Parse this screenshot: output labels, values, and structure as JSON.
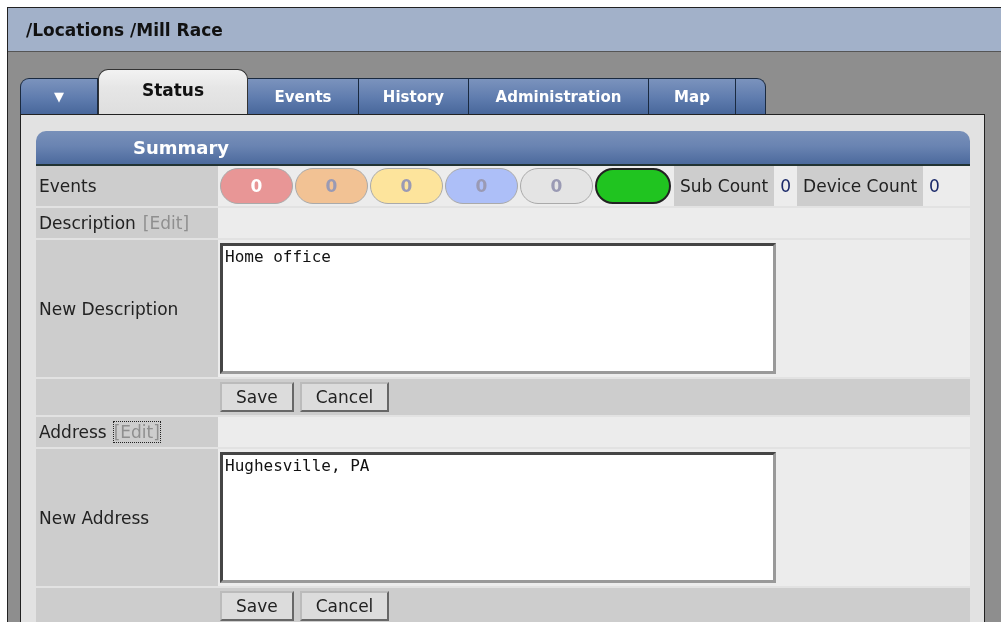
{
  "window": {
    "title": "/Locations /Mill Race"
  },
  "tabs": [
    {
      "kind": "menu",
      "label": "▼",
      "selected": false
    },
    {
      "kind": "tab",
      "label": "Status",
      "selected": true
    },
    {
      "kind": "tab",
      "label": "Events",
      "selected": false
    },
    {
      "kind": "tab",
      "label": "History",
      "selected": false
    },
    {
      "kind": "tab",
      "label": "Administration",
      "selected": false
    },
    {
      "kind": "tab",
      "label": "Map",
      "selected": false
    },
    {
      "kind": "stub",
      "selected": false
    }
  ],
  "summary": {
    "title": "Summary",
    "events": {
      "label": "Events",
      "pills": [
        {
          "count": "0",
          "color": "#e89696"
        },
        {
          "count": "0",
          "color": "#f2c294"
        },
        {
          "count": "0",
          "color": "#fde49c"
        },
        {
          "count": "0",
          "color": "#adbff8"
        },
        {
          "count": "0",
          "color": "#e4e4e4"
        },
        {
          "color": "#20c420"
        }
      ],
      "sub_count": {
        "label": "Sub Count",
        "value": "0"
      },
      "device_count": {
        "label": "Device Count",
        "value": "0"
      }
    },
    "fields": [
      {
        "label": "Description",
        "edit": "[Edit]",
        "focused": false,
        "new_label": "New Description",
        "value": "Home office",
        "buttons": [
          "Save",
          "Cancel"
        ]
      },
      {
        "label": "Address",
        "edit": "[Edit]",
        "focused": true,
        "new_label": "New Address",
        "value": "Hughesville, PA",
        "buttons": [
          "Save",
          "Cancel"
        ]
      }
    ]
  }
}
